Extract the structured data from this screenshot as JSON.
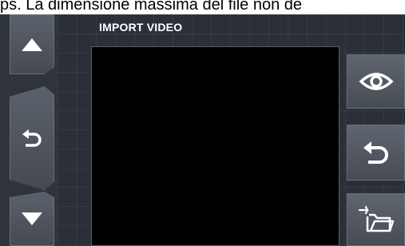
{
  "caption": {
    "text": "ps. La dimensione massima del file non de"
  },
  "header": {
    "title": "IMPORT VIDEO"
  },
  "left_nav": {
    "up": {
      "icon": "arrow-up-icon"
    },
    "back": {
      "icon": "back-arrow-icon"
    },
    "down": {
      "icon": "arrow-down-icon"
    }
  },
  "right_actions": {
    "view": {
      "icon": "eye-icon"
    },
    "back": {
      "icon": "back-arrow-icon"
    },
    "import_folder": {
      "icon": "folder-import-icon"
    }
  },
  "colors": {
    "screen_bg": "#2b3038",
    "button_face": "#5b616a",
    "preview_bg": "#000000",
    "icon": "#ffffff"
  }
}
